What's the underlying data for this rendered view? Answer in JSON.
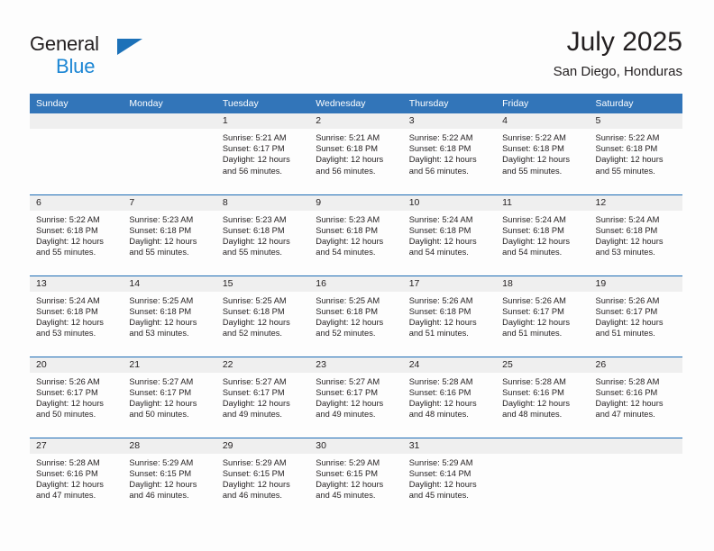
{
  "brand": {
    "line1": "General",
    "line2": "Blue",
    "triangle_color": "#1c71b8",
    "blue_color": "#1c86d4"
  },
  "header": {
    "title": "July 2025",
    "subtitle": "San Diego, Honduras"
  },
  "theme": {
    "header_blue": "#3275b9",
    "row_rule_blue": "#1c6cb5",
    "daynum_band": "#efefef",
    "text": "#231f20"
  },
  "weekday_headers": [
    "Sunday",
    "Monday",
    "Tuesday",
    "Wednesday",
    "Thursday",
    "Friday",
    "Saturday"
  ],
  "weeks": [
    [
      {
        "day": "",
        "lines": []
      },
      {
        "day": "",
        "lines": []
      },
      {
        "day": "1",
        "lines": [
          "Sunrise: 5:21 AM",
          "Sunset: 6:17 PM",
          "Daylight: 12 hours",
          "and 56 minutes."
        ]
      },
      {
        "day": "2",
        "lines": [
          "Sunrise: 5:21 AM",
          "Sunset: 6:18 PM",
          "Daylight: 12 hours",
          "and 56 minutes."
        ]
      },
      {
        "day": "3",
        "lines": [
          "Sunrise: 5:22 AM",
          "Sunset: 6:18 PM",
          "Daylight: 12 hours",
          "and 56 minutes."
        ]
      },
      {
        "day": "4",
        "lines": [
          "Sunrise: 5:22 AM",
          "Sunset: 6:18 PM",
          "Daylight: 12 hours",
          "and 55 minutes."
        ]
      },
      {
        "day": "5",
        "lines": [
          "Sunrise: 5:22 AM",
          "Sunset: 6:18 PM",
          "Daylight: 12 hours",
          "and 55 minutes."
        ]
      }
    ],
    [
      {
        "day": "6",
        "lines": [
          "Sunrise: 5:22 AM",
          "Sunset: 6:18 PM",
          "Daylight: 12 hours",
          "and 55 minutes."
        ]
      },
      {
        "day": "7",
        "lines": [
          "Sunrise: 5:23 AM",
          "Sunset: 6:18 PM",
          "Daylight: 12 hours",
          "and 55 minutes."
        ]
      },
      {
        "day": "8",
        "lines": [
          "Sunrise: 5:23 AM",
          "Sunset: 6:18 PM",
          "Daylight: 12 hours",
          "and 55 minutes."
        ]
      },
      {
        "day": "9",
        "lines": [
          "Sunrise: 5:23 AM",
          "Sunset: 6:18 PM",
          "Daylight: 12 hours",
          "and 54 minutes."
        ]
      },
      {
        "day": "10",
        "lines": [
          "Sunrise: 5:24 AM",
          "Sunset: 6:18 PM",
          "Daylight: 12 hours",
          "and 54 minutes."
        ]
      },
      {
        "day": "11",
        "lines": [
          "Sunrise: 5:24 AM",
          "Sunset: 6:18 PM",
          "Daylight: 12 hours",
          "and 54 minutes."
        ]
      },
      {
        "day": "12",
        "lines": [
          "Sunrise: 5:24 AM",
          "Sunset: 6:18 PM",
          "Daylight: 12 hours",
          "and 53 minutes."
        ]
      }
    ],
    [
      {
        "day": "13",
        "lines": [
          "Sunrise: 5:24 AM",
          "Sunset: 6:18 PM",
          "Daylight: 12 hours",
          "and 53 minutes."
        ]
      },
      {
        "day": "14",
        "lines": [
          "Sunrise: 5:25 AM",
          "Sunset: 6:18 PM",
          "Daylight: 12 hours",
          "and 53 minutes."
        ]
      },
      {
        "day": "15",
        "lines": [
          "Sunrise: 5:25 AM",
          "Sunset: 6:18 PM",
          "Daylight: 12 hours",
          "and 52 minutes."
        ]
      },
      {
        "day": "16",
        "lines": [
          "Sunrise: 5:25 AM",
          "Sunset: 6:18 PM",
          "Daylight: 12 hours",
          "and 52 minutes."
        ]
      },
      {
        "day": "17",
        "lines": [
          "Sunrise: 5:26 AM",
          "Sunset: 6:18 PM",
          "Daylight: 12 hours",
          "and 51 minutes."
        ]
      },
      {
        "day": "18",
        "lines": [
          "Sunrise: 5:26 AM",
          "Sunset: 6:17 PM",
          "Daylight: 12 hours",
          "and 51 minutes."
        ]
      },
      {
        "day": "19",
        "lines": [
          "Sunrise: 5:26 AM",
          "Sunset: 6:17 PM",
          "Daylight: 12 hours",
          "and 51 minutes."
        ]
      }
    ],
    [
      {
        "day": "20",
        "lines": [
          "Sunrise: 5:26 AM",
          "Sunset: 6:17 PM",
          "Daylight: 12 hours",
          "and 50 minutes."
        ]
      },
      {
        "day": "21",
        "lines": [
          "Sunrise: 5:27 AM",
          "Sunset: 6:17 PM",
          "Daylight: 12 hours",
          "and 50 minutes."
        ]
      },
      {
        "day": "22",
        "lines": [
          "Sunrise: 5:27 AM",
          "Sunset: 6:17 PM",
          "Daylight: 12 hours",
          "and 49 minutes."
        ]
      },
      {
        "day": "23",
        "lines": [
          "Sunrise: 5:27 AM",
          "Sunset: 6:17 PM",
          "Daylight: 12 hours",
          "and 49 minutes."
        ]
      },
      {
        "day": "24",
        "lines": [
          "Sunrise: 5:28 AM",
          "Sunset: 6:16 PM",
          "Daylight: 12 hours",
          "and 48 minutes."
        ]
      },
      {
        "day": "25",
        "lines": [
          "Sunrise: 5:28 AM",
          "Sunset: 6:16 PM",
          "Daylight: 12 hours",
          "and 48 minutes."
        ]
      },
      {
        "day": "26",
        "lines": [
          "Sunrise: 5:28 AM",
          "Sunset: 6:16 PM",
          "Daylight: 12 hours",
          "and 47 minutes."
        ]
      }
    ],
    [
      {
        "day": "27",
        "lines": [
          "Sunrise: 5:28 AM",
          "Sunset: 6:16 PM",
          "Daylight: 12 hours",
          "and 47 minutes."
        ]
      },
      {
        "day": "28",
        "lines": [
          "Sunrise: 5:29 AM",
          "Sunset: 6:15 PM",
          "Daylight: 12 hours",
          "and 46 minutes."
        ]
      },
      {
        "day": "29",
        "lines": [
          "Sunrise: 5:29 AM",
          "Sunset: 6:15 PM",
          "Daylight: 12 hours",
          "and 46 minutes."
        ]
      },
      {
        "day": "30",
        "lines": [
          "Sunrise: 5:29 AM",
          "Sunset: 6:15 PM",
          "Daylight: 12 hours",
          "and 45 minutes."
        ]
      },
      {
        "day": "31",
        "lines": [
          "Sunrise: 5:29 AM",
          "Sunset: 6:14 PM",
          "Daylight: 12 hours",
          "and 45 minutes."
        ]
      },
      {
        "day": "",
        "lines": []
      },
      {
        "day": "",
        "lines": []
      }
    ]
  ]
}
